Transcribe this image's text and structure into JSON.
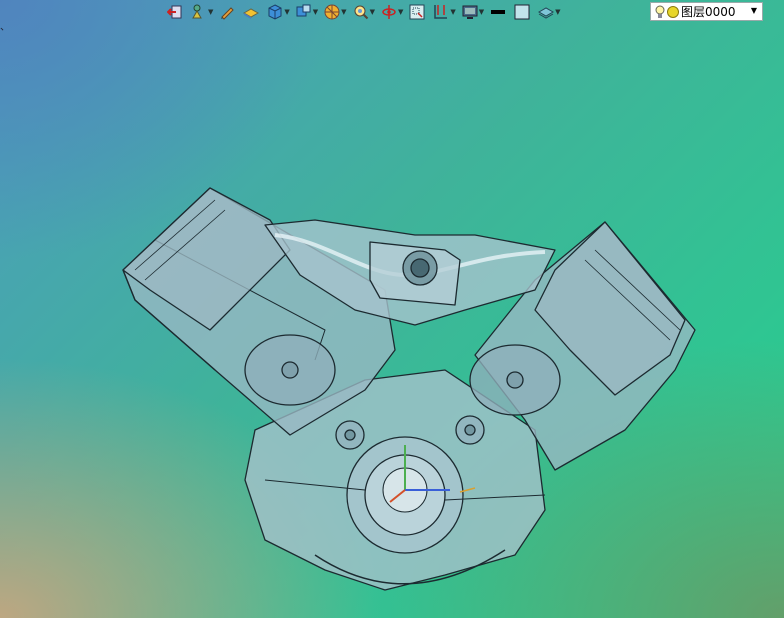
{
  "viewport": {
    "stray_text": "、"
  },
  "toolbar": {
    "items": [
      {
        "name": "exit-icon"
      },
      {
        "name": "selection-filter-icon",
        "dropdown": true
      },
      {
        "name": "sketch-pen-icon"
      },
      {
        "name": "plane-icon"
      },
      {
        "name": "view-cube-icon",
        "dropdown": true
      },
      {
        "name": "display-style-icon",
        "dropdown": true
      },
      {
        "name": "section-view-icon",
        "dropdown": true
      },
      {
        "name": "zoom-fit-icon",
        "dropdown": true
      },
      {
        "name": "rotate-view-icon",
        "dropdown": true
      },
      {
        "name": "zoom-area-icon"
      },
      {
        "name": "measure-icon",
        "dropdown": true
      },
      {
        "name": "monitor-icon",
        "dropdown": true
      },
      {
        "name": "line-color-icon"
      },
      {
        "name": "fill-color-icon"
      },
      {
        "name": "layers-icon",
        "dropdown": true
      }
    ]
  },
  "layer_selector": {
    "label": "图层0000"
  },
  "colors": {
    "bg_top_left": "#4e9bbf",
    "bg_top_right": "#24d28c",
    "bg_bottom_left": "#c4a680",
    "model_fill": "#9ab8c4",
    "model_edge": "#1c2a30"
  }
}
